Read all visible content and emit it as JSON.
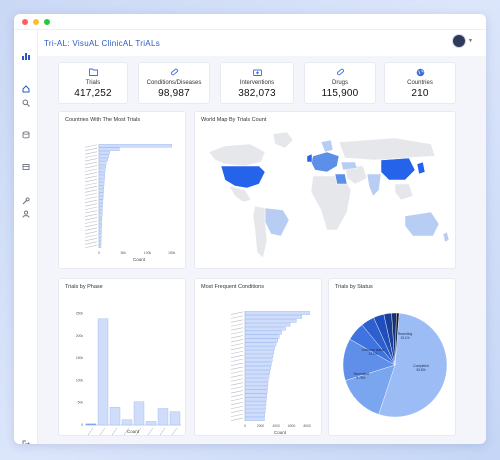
{
  "app": {
    "title": "Tri-AL: VisuAL ClinicAL TriALs"
  },
  "stats": [
    {
      "label": "Trials",
      "value": "417,252",
      "icon": "folder-icon"
    },
    {
      "label": "Conditions/Diseases",
      "value": "98,987",
      "icon": "pill-icon"
    },
    {
      "label": "Interventions",
      "value": "382,073",
      "icon": "medkit-icon"
    },
    {
      "label": "Drugs",
      "value": "115,900",
      "icon": "capsule-icon"
    },
    {
      "label": "Countries",
      "value": "210",
      "icon": "globe-icon"
    }
  ],
  "panels": {
    "countries": {
      "title": "Countries With The Most Trials",
      "xlabel": "Count"
    },
    "map": {
      "title": "World Map By Trials Count"
    },
    "phase": {
      "title": "Trials by Phase",
      "xlabel": "Count"
    },
    "conditions": {
      "title": "Most Frequent Conditions",
      "xlabel": "Count"
    },
    "status": {
      "title": "Trials by Status"
    }
  },
  "colors": {
    "accent": "#2b59c3",
    "bar_fill": "#cfddfb",
    "bar_stroke": "#8fb0ef",
    "map_dark": "#2563eb",
    "map_mid": "#5b8fe8",
    "map_light": "#b7cdf3",
    "map_gray": "#e5e7eb"
  },
  "chart_data": [
    {
      "type": "bar",
      "orientation": "horizontal",
      "title": "Countries With The Most Trials",
      "xlabel": "Count",
      "xticks": [
        "0",
        "50k",
        "100k",
        "150k"
      ],
      "xlim": [
        0,
        165000
      ],
      "values": [
        150000,
        42000,
        22000,
        20000,
        18000,
        15000,
        14000,
        13000,
        12000,
        12000,
        11000,
        10500,
        10000,
        9500,
        9000,
        8500,
        8000,
        7500,
        7000,
        6800,
        6500,
        6000,
        5800,
        5500,
        5200,
        5000,
        4800,
        4500,
        4300,
        4000
      ]
    },
    {
      "type": "bar",
      "title": "Trials by Phase",
      "xlabel": "Count",
      "yticks": [
        "0",
        "50k",
        "100k",
        "150k",
        "200k",
        "250k"
      ],
      "ylim": [
        0,
        260000
      ],
      "values": [
        2000,
        238000,
        40000,
        12000,
        52000,
        8000,
        37000,
        30000
      ]
    },
    {
      "type": "bar",
      "orientation": "horizontal",
      "title": "Most Frequent Conditions",
      "xlabel": "Count",
      "xticks": [
        "0",
        "2000",
        "4000",
        "6000",
        "8000"
      ],
      "xlim": [
        0,
        9000
      ],
      "values": [
        8300,
        7300,
        6600,
        5800,
        5200,
        4700,
        4400,
        4200,
        4000,
        3800,
        3700,
        3600,
        3500,
        3400,
        3300,
        3200,
        3100,
        3000,
        2950,
        2900,
        2850,
        2800,
        2750,
        2700,
        2650,
        2600,
        2550,
        2500
      ]
    },
    {
      "type": "pie",
      "title": "Trials by Status",
      "slices": [
        {
          "label": "Completed",
          "pct": "53.8%",
          "value": 53.8,
          "color": "#9bbcf4"
        },
        {
          "label": "Recruiting",
          "pct": "15.1%",
          "value": 15.1,
          "color": "#7aa5ef"
        },
        {
          "label": "Unknown status",
          "pct": "13.1%",
          "value": 13.1,
          "color": "#5f8fe9"
        },
        {
          "label": "Terminated",
          "pct": "5.78%",
          "value": 5.78,
          "color": "#3f74e0"
        },
        {
          "label": "",
          "pct": "",
          "value": 4.2,
          "color": "#2d5fd0"
        },
        {
          "label": "",
          "pct": "",
          "value": 3.3,
          "color": "#1f4fbd"
        },
        {
          "label": "",
          "pct": "",
          "value": 2.4,
          "color": "#1a3f9a"
        },
        {
          "label": "",
          "pct": "",
          "value": 1.5,
          "color": "#17306f"
        },
        {
          "label": "",
          "pct": "",
          "value": 0.82,
          "color": "#101c3f"
        }
      ]
    }
  ]
}
